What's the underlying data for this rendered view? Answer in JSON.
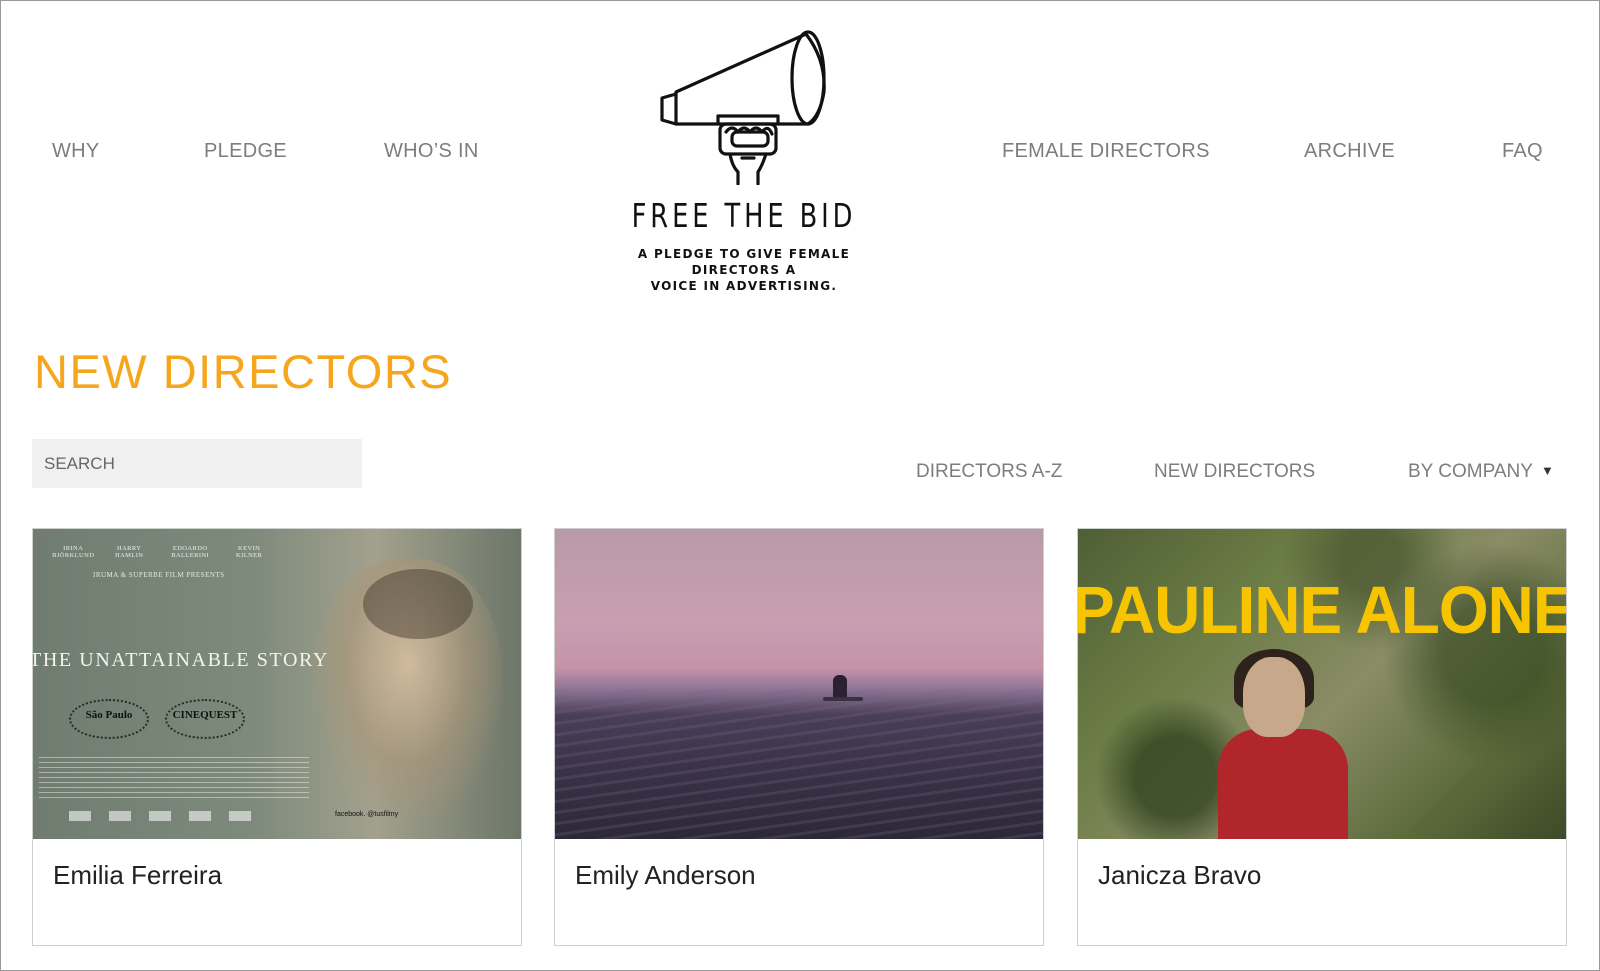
{
  "nav": {
    "left": [
      "WHY",
      "PLEDGE",
      "WHO’S IN"
    ],
    "right": [
      "FEMALE DIRECTORS",
      "ARCHIVE",
      "FAQ"
    ]
  },
  "logo": {
    "title": "FREE THE BID",
    "tagline_line1": "A PLEDGE TO GIVE FEMALE DIRECTORS A",
    "tagline_line2": "VOICE IN ADVERTISING.",
    "icon": "megaphone-hand-icon"
  },
  "page": {
    "title": "NEW DIRECTORS",
    "title_color": "#f5a61c"
  },
  "search": {
    "placeholder": "SEARCH"
  },
  "filters": {
    "directors_az": "DIRECTORS A-Z",
    "new_directors": "NEW DIRECTORS",
    "by_company": "BY COMPANY",
    "by_company_icon": "caret-down-icon"
  },
  "cards": [
    {
      "name": "Emilia Ferreira",
      "thumb": {
        "credits": [
          "IRINA BJÖRKLUND",
          "HARRY HAMLIN",
          "EDOARDO BALLERINI",
          "KEVIN KILNER"
        ],
        "presents": "IRUMA & SUPERBE FILM PRESENTS",
        "title": "THE UNATTAINABLE STORY",
        "laurel1": "São Paulo",
        "laurel2": "CINEQUEST",
        "footer": "facebook. @tusfilmy"
      }
    },
    {
      "name": "Emily Anderson"
    },
    {
      "name": "Janicza Bravo",
      "thumb": {
        "title": "PAULINE ALONE"
      }
    }
  ]
}
